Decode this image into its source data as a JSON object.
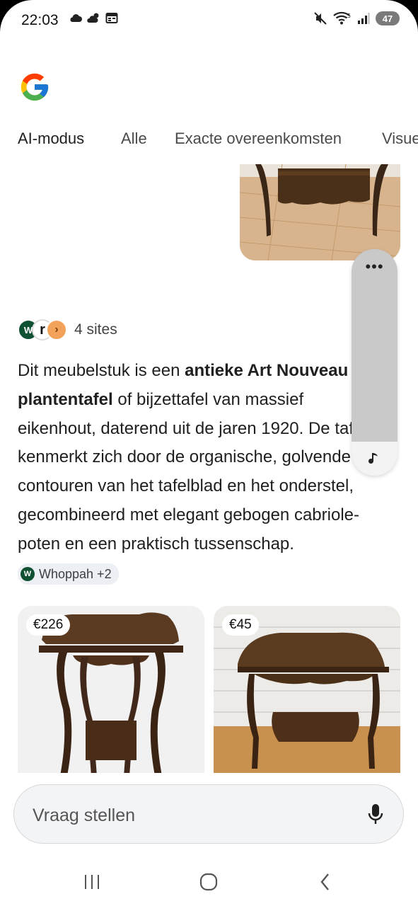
{
  "status_bar": {
    "time": "22:03",
    "battery": "47"
  },
  "tabs": [
    {
      "label": "AI-modus",
      "active": true
    },
    {
      "label": "Alle",
      "active": false
    },
    {
      "label": "Exacte overeenkomsten",
      "active": false
    },
    {
      "label": "Visue",
      "active": false
    }
  ],
  "sources": {
    "label": "4 sites",
    "icons": [
      "whoppah-icon",
      "r-site-icon",
      "orange-site-icon"
    ]
  },
  "paragraph": {
    "t1": "Dit meubelstuk is een ",
    "b1": "antieke Art Nouveau plantentafel",
    "t2": " of bijzettafel van massief eikenhout, daterend uit de jaren 1920. De tafel kenmerkt zich door de organische, golvende contouren van het tafelblad en het onderstel, gecombineerd met elegant gebogen cabriole-poten en een praktisch tussenschap."
  },
  "citation_chip": {
    "label": "Whoppah +2"
  },
  "products": [
    {
      "price": "€226"
    },
    {
      "price": "€45"
    }
  ],
  "floating_pill": {
    "menu": "•••"
  },
  "ask": {
    "placeholder": "Vraag stellen",
    "value": ""
  },
  "colors": {
    "accent": "#1a73e8",
    "brand_green": "#0f5132",
    "chip_bg": "#eceff3"
  }
}
